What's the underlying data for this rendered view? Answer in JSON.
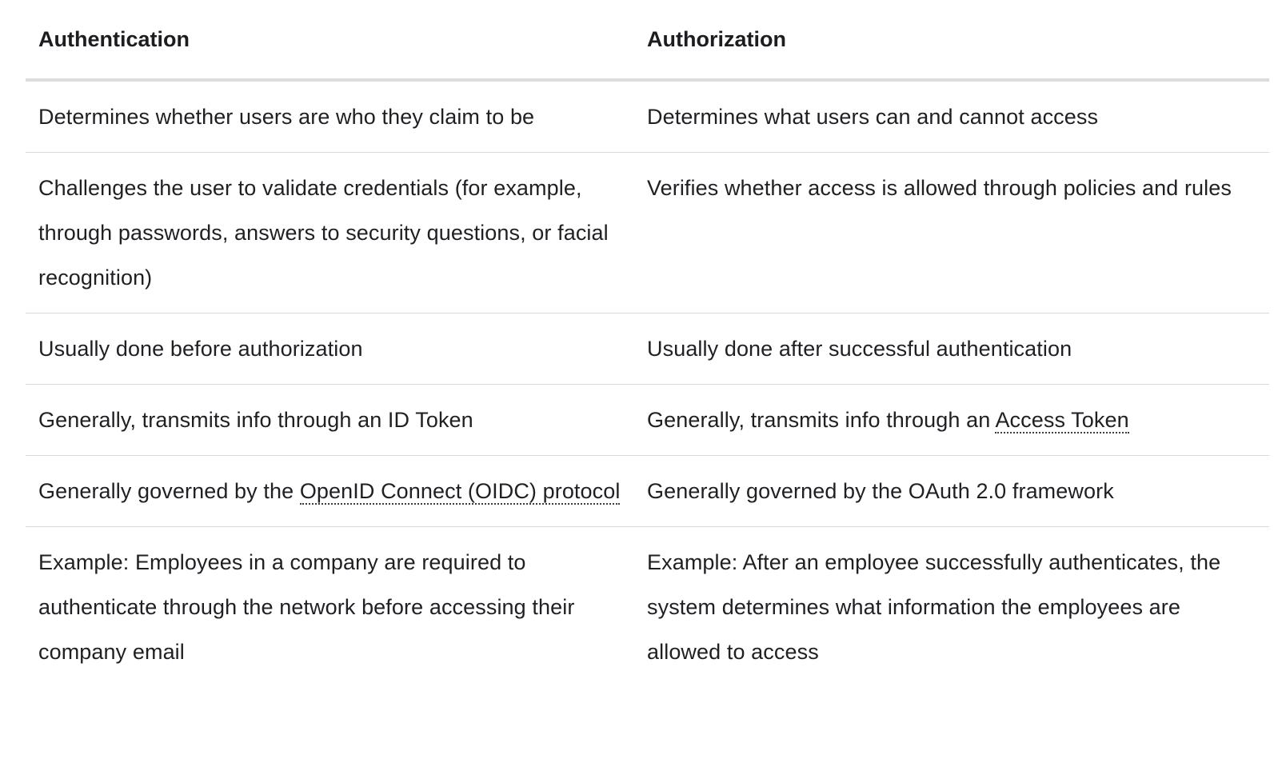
{
  "table": {
    "headers": {
      "authentication": "Authentication",
      "authorization": "Authorization"
    },
    "rows": [
      {
        "authentication": "Determines whether users are who they claim to be",
        "authorization": "Determines what users can and cannot access"
      },
      {
        "authentication": "Challenges the user to validate credentials (for example, through passwords, answers to security questions, or facial recognition)",
        "authorization": "Verifies whether access is allowed through policies and rules"
      },
      {
        "authentication": "Usually done before authorization",
        "authorization": "Usually done after successful authentication"
      },
      {
        "authentication": "Generally, transmits info through an ID Token",
        "authorization_prefix": "Generally, transmits info through an ",
        "authorization_link": "Access Token"
      },
      {
        "authentication_prefix": "Generally governed by the ",
        "authentication_link": "OpenID Connect (OIDC) protocol",
        "authorization": "Generally governed by the OAuth 2.0 framework"
      },
      {
        "authentication": "Example: Employees in a company are required to authenticate through the network before accessing their company email",
        "authorization": "Example: After an employee successfully authenticates, the system determines what information the employees are allowed to access"
      }
    ]
  }
}
